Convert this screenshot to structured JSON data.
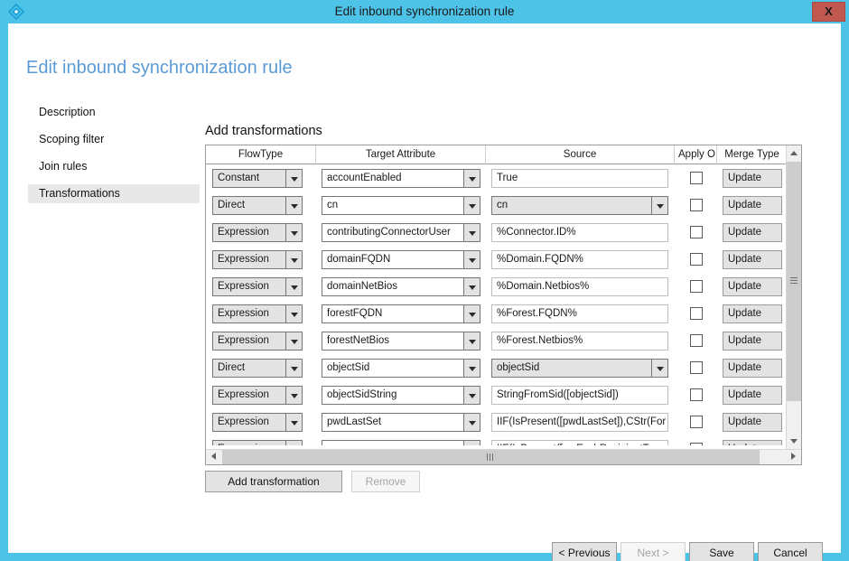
{
  "window": {
    "title": "Edit inbound synchronization rule",
    "icon": "sync-diamond-icon",
    "close_label": "X",
    "accent_color": "#4ec3e8",
    "close_color": "#c0584f"
  },
  "page": {
    "title": "Edit inbound synchronization rule",
    "title_color": "#5b9bd5"
  },
  "sidebar": {
    "items": [
      {
        "label": "Description",
        "active": false
      },
      {
        "label": "Scoping filter",
        "active": false
      },
      {
        "label": "Join rules",
        "active": false
      },
      {
        "label": "Transformations",
        "active": true
      }
    ]
  },
  "main": {
    "section_title": "Add transformations",
    "grid": {
      "columns": [
        {
          "label": "FlowType"
        },
        {
          "label": "Target Attribute"
        },
        {
          "label": "Source"
        },
        {
          "label": "Apply O"
        },
        {
          "label": "Merge Type"
        }
      ],
      "rows": [
        {
          "flow_type": "Constant",
          "target_attribute": "accountEnabled",
          "source": "True",
          "source_kind": "text",
          "apply_once": false,
          "merge_type": "Update"
        },
        {
          "flow_type": "Direct",
          "target_attribute": "cn",
          "source": "cn",
          "source_kind": "combo",
          "apply_once": false,
          "merge_type": "Update"
        },
        {
          "flow_type": "Expression",
          "target_attribute": "contributingConnectorUser",
          "source": "%Connector.ID%",
          "source_kind": "text",
          "apply_once": false,
          "merge_type": "Update"
        },
        {
          "flow_type": "Expression",
          "target_attribute": "domainFQDN",
          "source": "%Domain.FQDN%",
          "source_kind": "text",
          "apply_once": false,
          "merge_type": "Update"
        },
        {
          "flow_type": "Expression",
          "target_attribute": "domainNetBios",
          "source": "%Domain.Netbios%",
          "source_kind": "text",
          "apply_once": false,
          "merge_type": "Update"
        },
        {
          "flow_type": "Expression",
          "target_attribute": "forestFQDN",
          "source": "%Forest.FQDN%",
          "source_kind": "text",
          "apply_once": false,
          "merge_type": "Update"
        },
        {
          "flow_type": "Expression",
          "target_attribute": "forestNetBios",
          "source": "%Forest.Netbios%",
          "source_kind": "text",
          "apply_once": false,
          "merge_type": "Update"
        },
        {
          "flow_type": "Direct",
          "target_attribute": "objectSid",
          "source": "objectSid",
          "source_kind": "combo",
          "apply_once": false,
          "merge_type": "Update"
        },
        {
          "flow_type": "Expression",
          "target_attribute": "objectSidString",
          "source": "StringFromSid([objectSid])",
          "source_kind": "text",
          "apply_once": false,
          "merge_type": "Update"
        },
        {
          "flow_type": "Expression",
          "target_attribute": "pwdLastSet",
          "source": "IIF(IsPresent([pwdLastSet]),CStr(For",
          "source_kind": "text",
          "apply_once": false,
          "merge_type": "Update"
        },
        {
          "flow_type": "Expression",
          "target_attribute": "",
          "source": "IIF(IsPresent([msExchRecipientType",
          "source_kind": "text",
          "apply_once": false,
          "merge_type": "Update"
        }
      ]
    },
    "add_transformation_label": "Add transformation",
    "remove_label": "Remove",
    "remove_enabled": false
  },
  "footer": {
    "previous_label": "< Previous",
    "next_label": "Next >",
    "next_enabled": false,
    "save_label": "Save",
    "cancel_label": "Cancel"
  }
}
